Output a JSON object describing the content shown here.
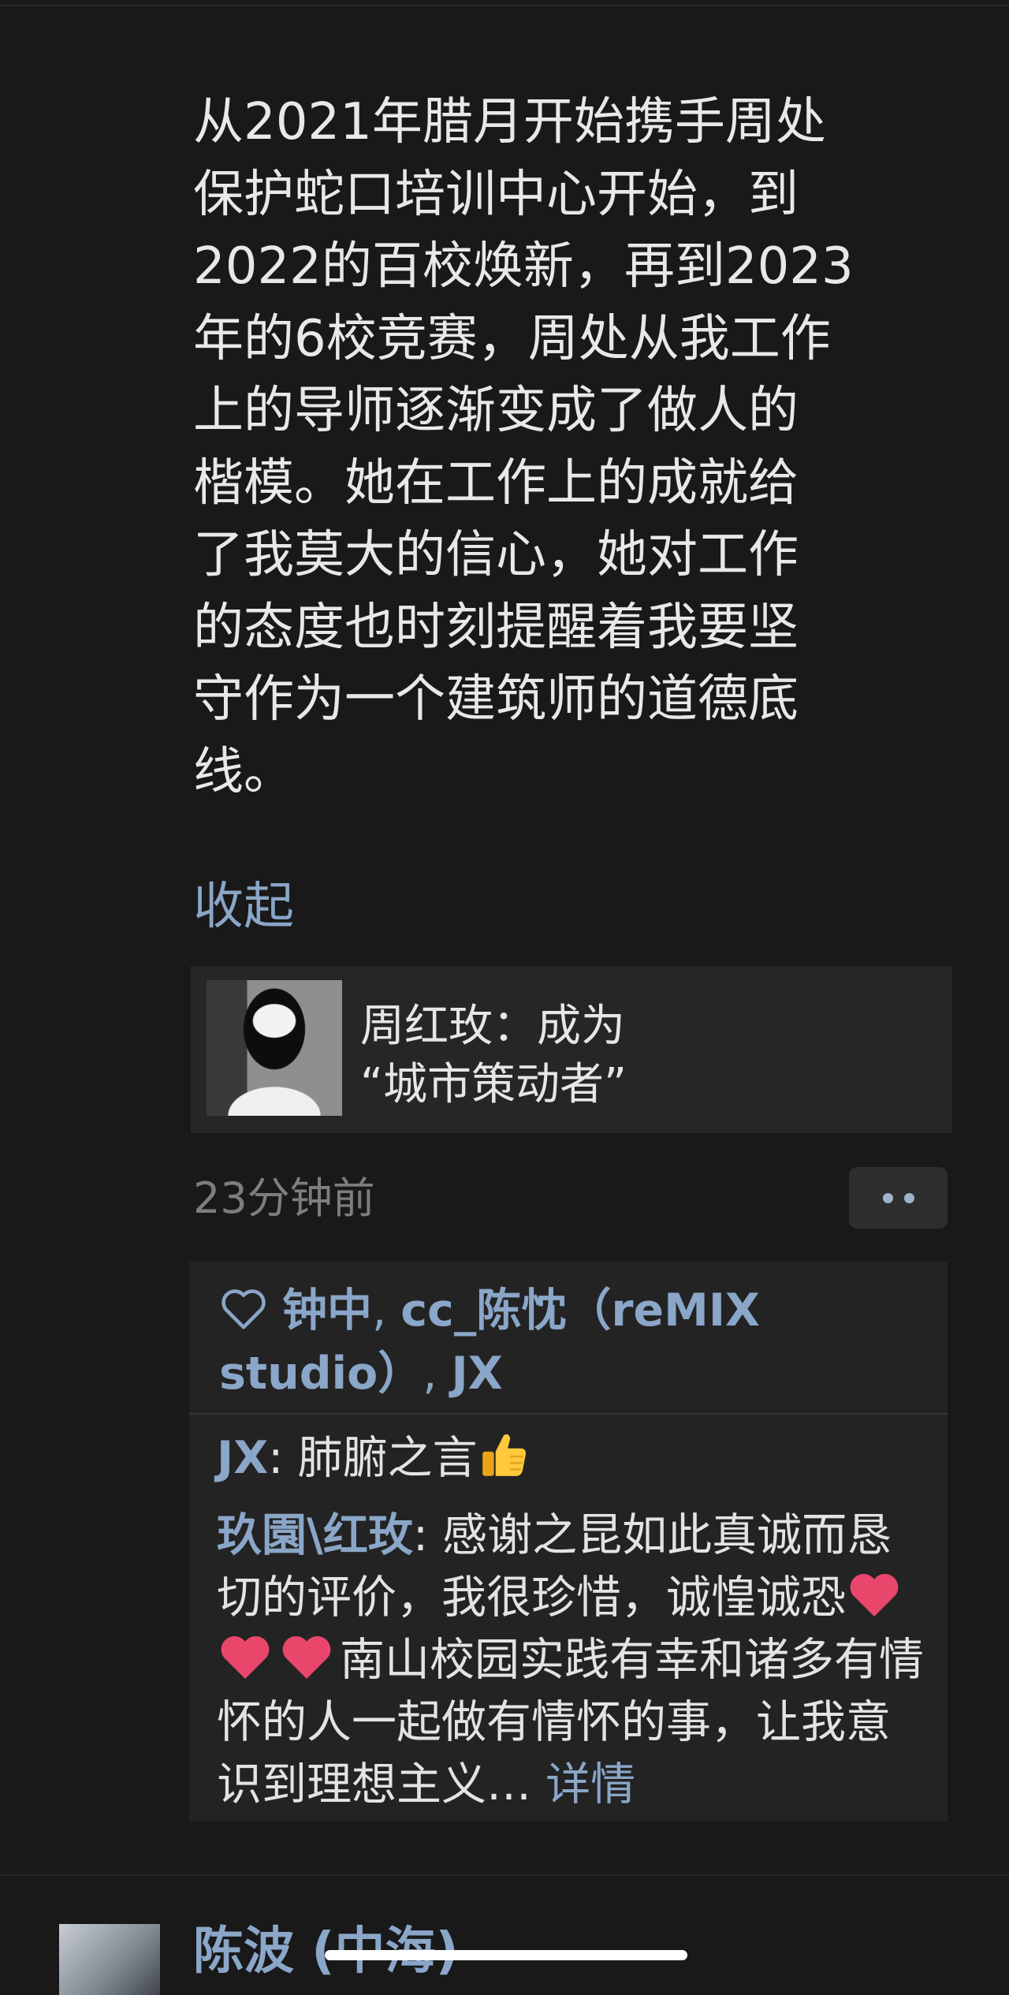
{
  "post": {
    "text": "从2021年腊月开始携手周处\n保护蛇口培训中心开始，到\n2022的百校焕新，再到2023\n年的6校竞赛，周处从我工作\n上的导师逐渐变成了做人的\n楷模。她在工作上的成就给\n了我莫大的信心，她对工作\n的态度也时刻提醒着我要坚\n守作为一个建筑师的道德底\n线。",
    "collapse_label": "收起"
  },
  "article": {
    "title": "周红玫：成为\n“城市策动者”"
  },
  "meta": {
    "timestamp": "23分钟前"
  },
  "likes": {
    "names": [
      "钟中",
      "cc_陈忱（reMIX studio）",
      "JX"
    ],
    "separator": ", "
  },
  "comments": [
    {
      "author": "JX",
      "separator": ": ",
      "text": "肺腑之言"
    },
    {
      "author": "玖園\\红玫",
      "separator": ": ",
      "text_before": "感谢之昆如此真诚而恳切的评价，我很珍惜，诚惶诚恐",
      "text_after": "南山校园实践有幸和诸多有情怀的人一起做有情怀的事，让我意识到理想主义…",
      "detail_label": "详情"
    }
  ],
  "next_post": {
    "author": "陈波 (中海)"
  },
  "colors": {
    "link": "#8aa6c8",
    "background": "#191919",
    "panel": "#232323"
  },
  "icons": {
    "like": "heart-outline-icon",
    "more": "two-dot-more-icon",
    "emoji_thumb": "thumbs-up-emoji",
    "emoji_heart": "red-heart-emoji"
  }
}
